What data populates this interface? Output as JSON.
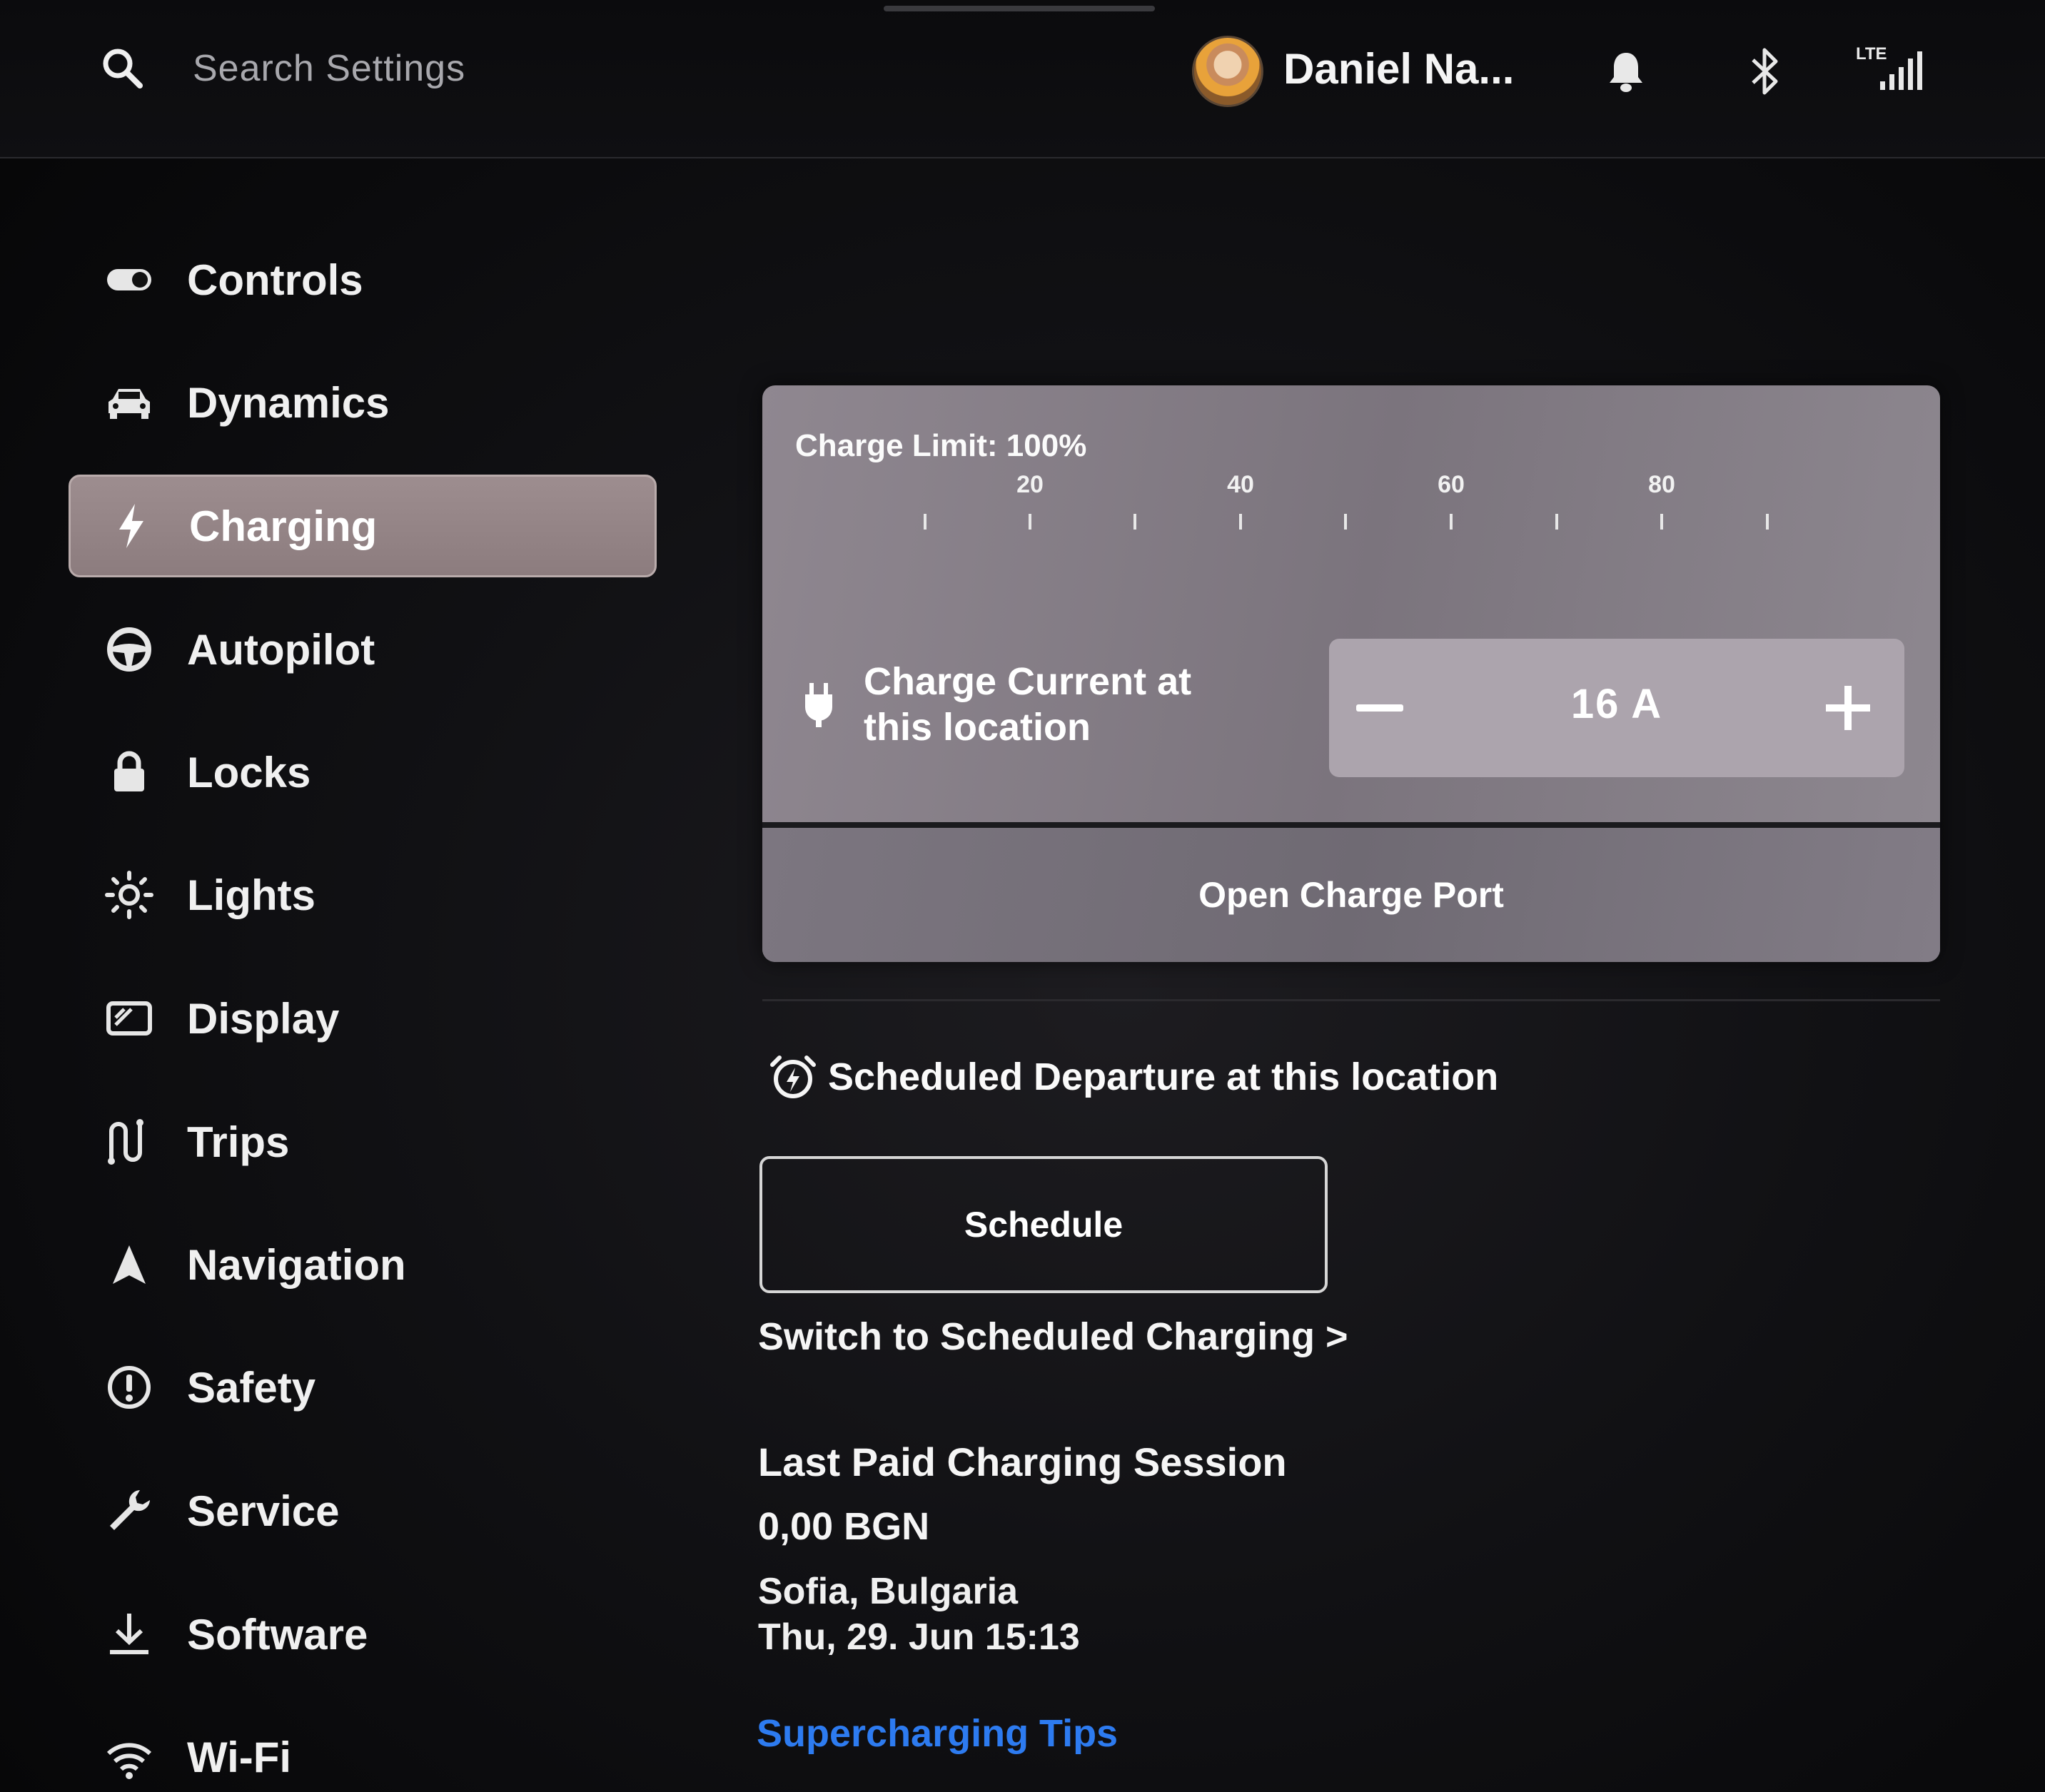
{
  "header": {
    "search_placeholder": "Search Settings",
    "user_name": "Daniel Na...",
    "network_label": "LTE"
  },
  "sidebar": {
    "items": [
      {
        "label": "Controls",
        "icon": "toggle-icon"
      },
      {
        "label": "Dynamics",
        "icon": "car-icon"
      },
      {
        "label": "Charging",
        "icon": "lightning-icon",
        "active": true
      },
      {
        "label": "Autopilot",
        "icon": "steering-wheel-icon"
      },
      {
        "label": "Locks",
        "icon": "lock-icon"
      },
      {
        "label": "Lights",
        "icon": "sun-icon"
      },
      {
        "label": "Display",
        "icon": "display-icon"
      },
      {
        "label": "Trips",
        "icon": "trips-icon"
      },
      {
        "label": "Navigation",
        "icon": "navigation-arrow-icon"
      },
      {
        "label": "Safety",
        "icon": "exclamation-circle-icon"
      },
      {
        "label": "Service",
        "icon": "wrench-icon"
      },
      {
        "label": "Software",
        "icon": "download-icon"
      },
      {
        "label": "Wi-Fi",
        "icon": "wifi-icon"
      }
    ]
  },
  "charging": {
    "limit_label": "Charge Limit: 100%",
    "limit_value_percent": 100,
    "scale_labels": [
      "20",
      "40",
      "60",
      "80"
    ],
    "current_label_line1": "Charge Current at",
    "current_label_line2": "this location",
    "current_value": "16 A",
    "open_port_label": "Open Charge Port"
  },
  "departure": {
    "title": "Scheduled Departure at this location",
    "schedule_button": "Schedule",
    "switch_link": "Switch to Scheduled Charging >"
  },
  "last_session": {
    "title": "Last Paid Charging Session",
    "amount": "0,00 BGN",
    "location": "Sofia, Bulgaria",
    "time": "Thu, 29. Jun 15:13"
  },
  "tips_link": "Supercharging Tips",
  "colors": {
    "accent_link": "#2d7bf0",
    "active_item_bg": "#9d8d8f",
    "card_bg": "#857e87"
  }
}
